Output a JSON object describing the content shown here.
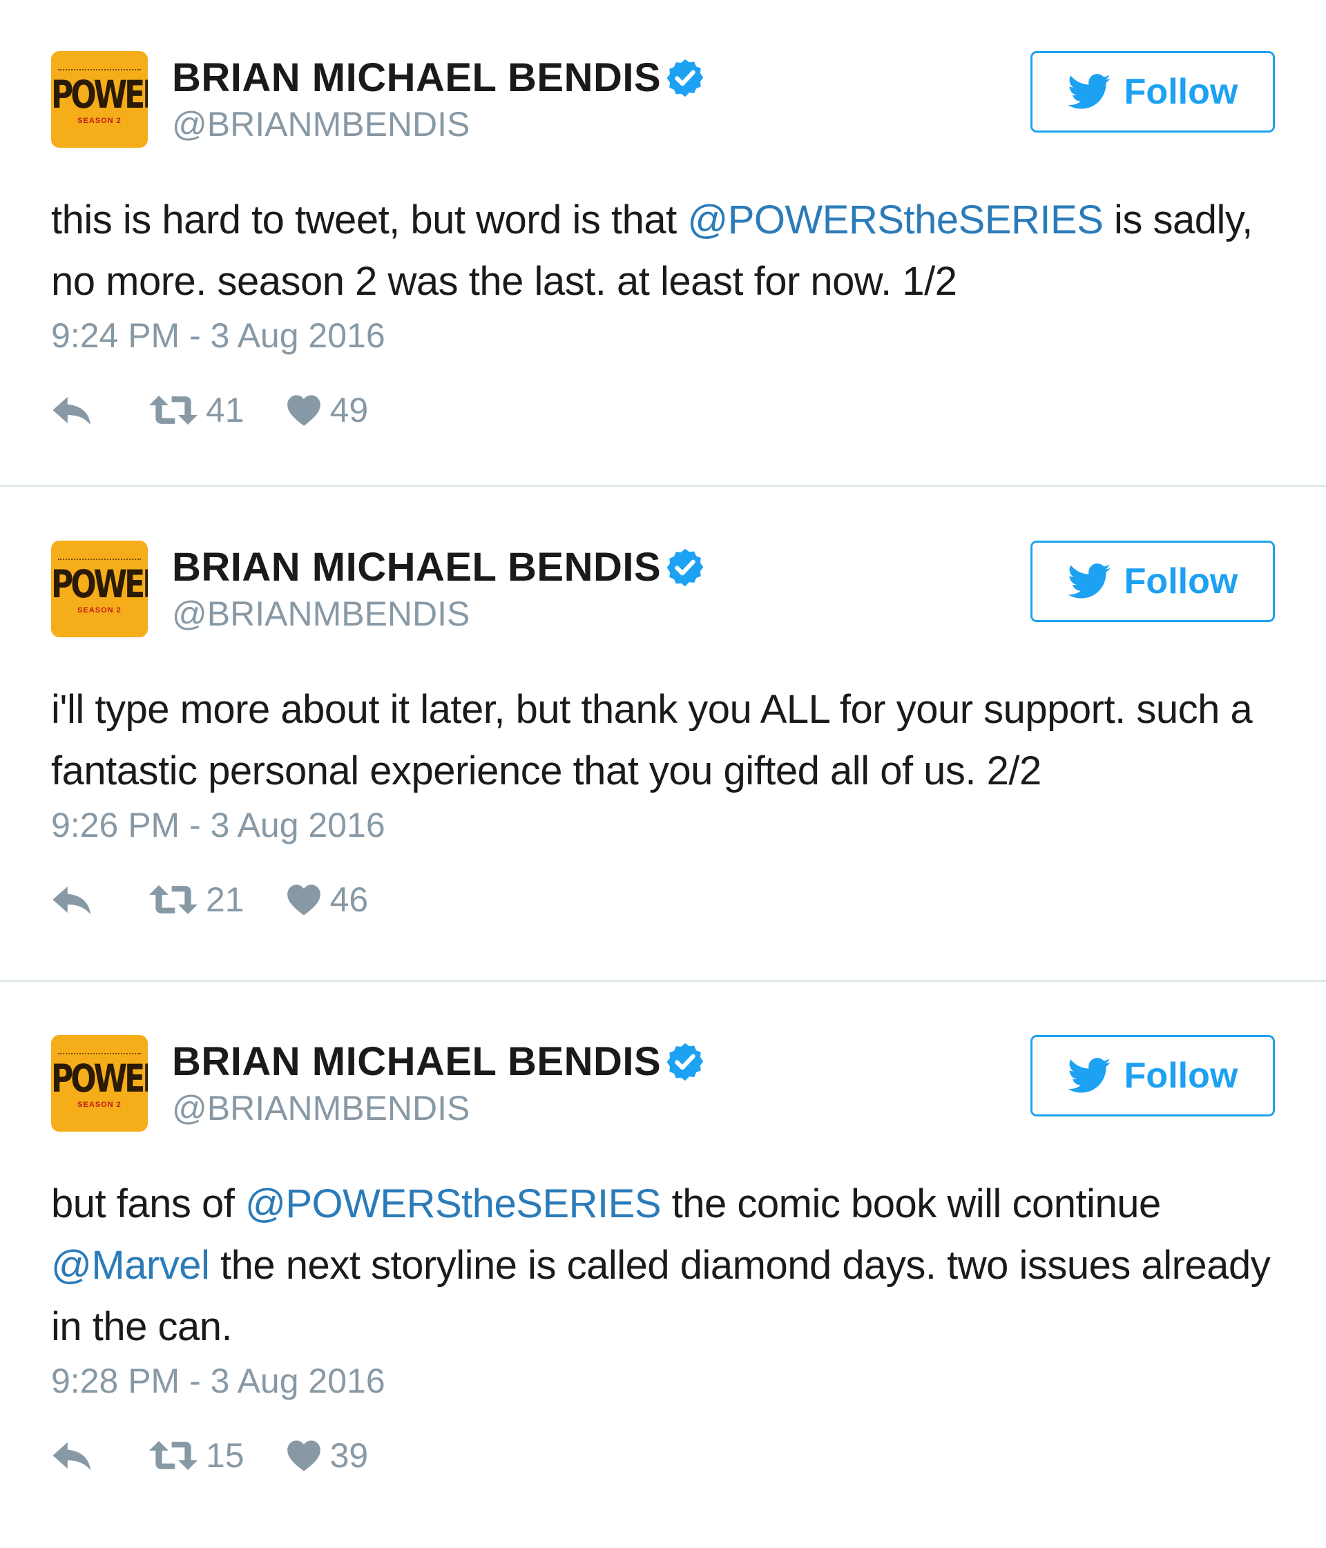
{
  "colors": {
    "accent": "#1da1f2",
    "mention": "#2b7bb9",
    "muted": "#8899a6",
    "avatar_bg": "#f5ad1a"
  },
  "avatar": {
    "title": "POWERS",
    "subtitle": "SEASON 2"
  },
  "follow_label": "Follow",
  "tweets": [
    {
      "name": "BRIAN MICHAEL BENDIS",
      "handle": "@BRIANMBENDIS",
      "text_parts": [
        "this is hard to tweet, but word is that ",
        "@POWERStheSERIES",
        " is sadly, no more. season 2 was the last. at least for now. 1/2"
      ],
      "timestamp": "9:24 PM - 3 Aug 2016",
      "retweets": "41",
      "likes": "49"
    },
    {
      "name": "BRIAN MICHAEL BENDIS",
      "handle": "@BRIANMBENDIS",
      "text_parts": [
        "i'll type more about it later, but thank you ALL for your support. such a fantastic personal experience that you gifted all of us. 2/2"
      ],
      "timestamp": "9:26 PM - 3 Aug 2016",
      "retweets": "21",
      "likes": "46"
    },
    {
      "name": "BRIAN MICHAEL BENDIS",
      "handle": "@BRIANMBENDIS",
      "text_parts": [
        "but fans of ",
        "@POWERStheSERIES",
        " the comic book will continue ",
        "@Marvel",
        " the next storyline is called diamond days. two issues already in the can."
      ],
      "timestamp": "9:28 PM - 3 Aug 2016",
      "retweets": "15",
      "likes": "39"
    }
  ]
}
